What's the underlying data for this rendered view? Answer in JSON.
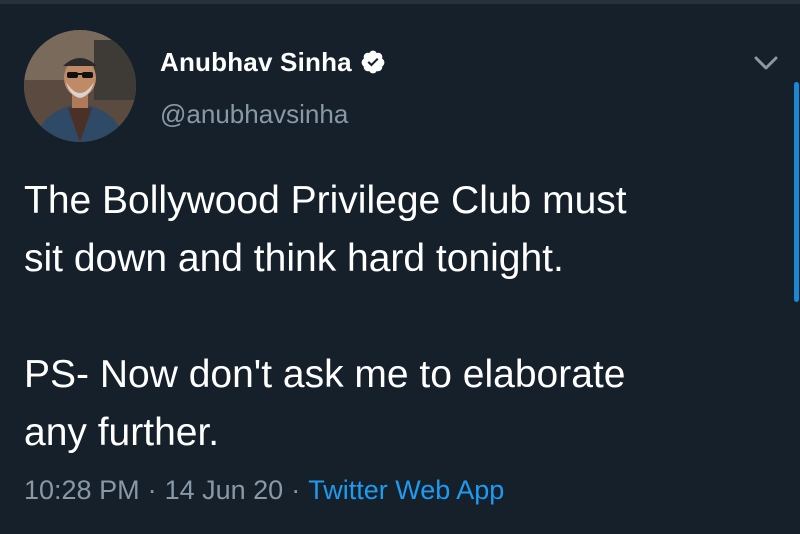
{
  "tweet": {
    "author": {
      "display_name": "Anubhav Sinha",
      "handle": "@anubhavsinha",
      "verified": true
    },
    "text_lines": [
      "The Bollywood Privilege Club must\nsit down and think hard tonight.",
      "PS- Now don't ask me to elaborate\nany further."
    ],
    "time": "10:28 PM",
    "date": "14 Jun 20",
    "separator": "·",
    "source": "Twitter Web App"
  },
  "icons": {
    "verified": "verified-badge-icon",
    "more": "chevron-down-icon"
  },
  "colors": {
    "background": "#15202b",
    "text": "#ffffff",
    "secondary_text": "#8899a6",
    "accent": "#1d9bf0"
  }
}
